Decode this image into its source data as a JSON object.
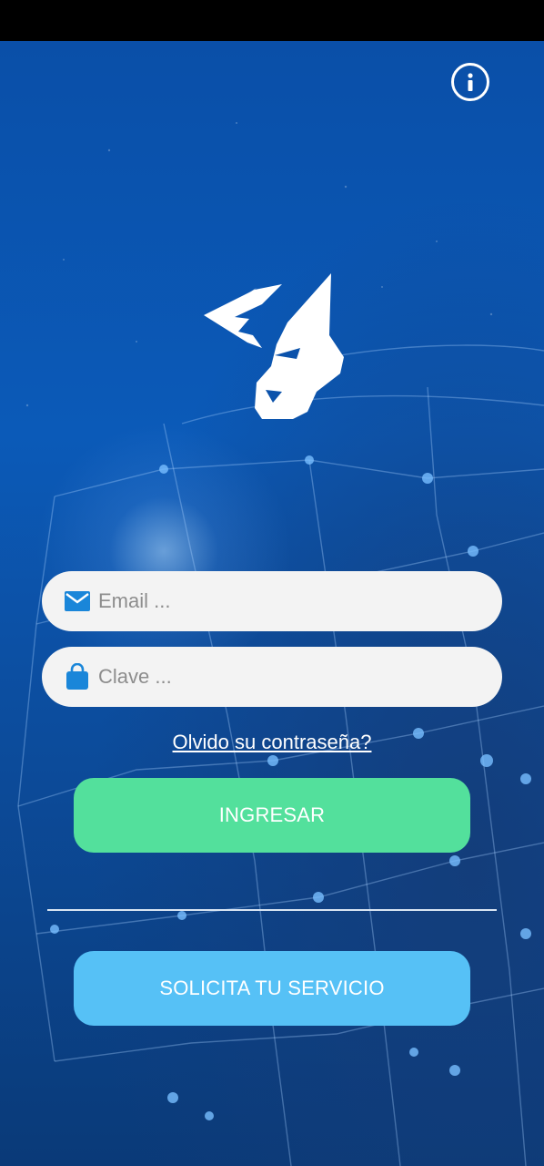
{
  "app": {
    "icons": {
      "info": "info-icon",
      "logo": "wolf-logo",
      "email": "envelope-icon",
      "password": "bag-lock-icon"
    },
    "colors": {
      "background": "#0b52ab",
      "field_bg": "#f3f3f3",
      "icon_blue": "#1a86d9",
      "login_button": "#53e09c",
      "service_button": "#56c1f6",
      "text_white": "#ffffff"
    }
  },
  "login": {
    "email_placeholder": "Email ...",
    "password_placeholder": "Clave ...",
    "forgot_password": "Olvido su contraseña?",
    "login_button": "INGRESAR",
    "service_button": "SOLICITA TU SERVICIO"
  }
}
